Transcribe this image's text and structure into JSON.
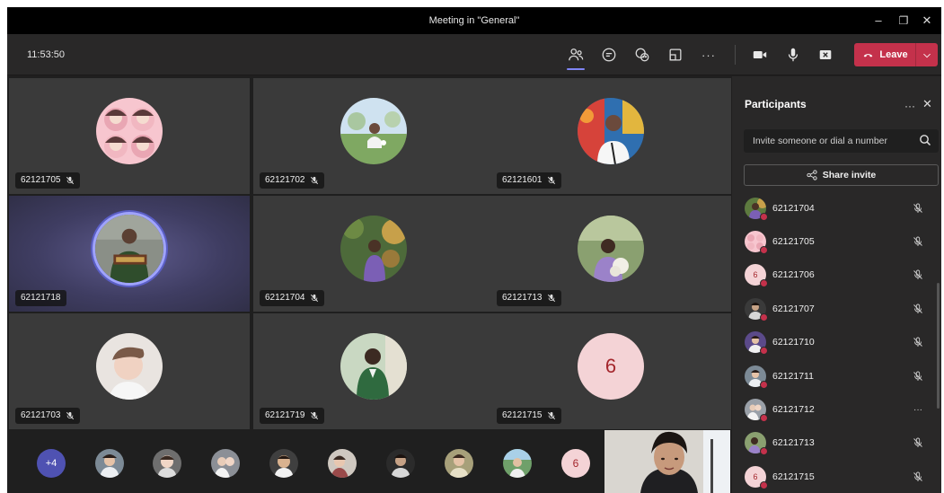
{
  "window": {
    "title": "Meeting in \"General\"",
    "minimize": "–",
    "maximize": "❐",
    "close": "✕"
  },
  "toolbar": {
    "timer": "11:53:50",
    "more": "···",
    "leave_label": "Leave",
    "leave_dropdown": "⌵",
    "icons": [
      "people-icon",
      "chat-icon",
      "reactions-icon",
      "share-tray-icon",
      "more-options-icon",
      "camera-icon",
      "mic-icon",
      "share-screen-icon",
      "phone-icon"
    ],
    "leave_color": "#c4314b",
    "active_indicator_color": "#7f85f5"
  },
  "grid": {
    "tiles": [
      {
        "name": "62121705",
        "muted": true,
        "speaking": false
      },
      {
        "name": "62121702",
        "muted": true,
        "speaking": false
      },
      {
        "name": "62121601",
        "muted": true,
        "speaking": false
      },
      {
        "name": "62121718",
        "muted": false,
        "speaking": true
      },
      {
        "name": "62121704",
        "muted": true,
        "speaking": false
      },
      {
        "name": "62121713",
        "muted": true,
        "speaking": false
      },
      {
        "name": "62121703",
        "muted": true,
        "speaking": false
      },
      {
        "name": "62121719",
        "muted": true,
        "speaking": false
      },
      {
        "name": "62121715",
        "muted": true,
        "speaking": false,
        "initial": "6"
      }
    ]
  },
  "strip": {
    "overflow_label": "+4",
    "initial_label": "6"
  },
  "panel": {
    "title": "Participants",
    "more": "···",
    "close": "✕",
    "invite_placeholder": "Invite someone or dial a number",
    "share_label": "Share invite",
    "participants": [
      {
        "name": "62121704",
        "status": "muted"
      },
      {
        "name": "62121705",
        "status": "muted"
      },
      {
        "name": "62121706",
        "status": "muted",
        "initial": "6"
      },
      {
        "name": "62121707",
        "status": "muted"
      },
      {
        "name": "62121710",
        "status": "muted"
      },
      {
        "name": "62121711",
        "status": "muted"
      },
      {
        "name": "62121712",
        "status": "more"
      },
      {
        "name": "62121713",
        "status": "muted"
      },
      {
        "name": "62121715",
        "status": "muted",
        "initial": "6"
      }
    ]
  }
}
